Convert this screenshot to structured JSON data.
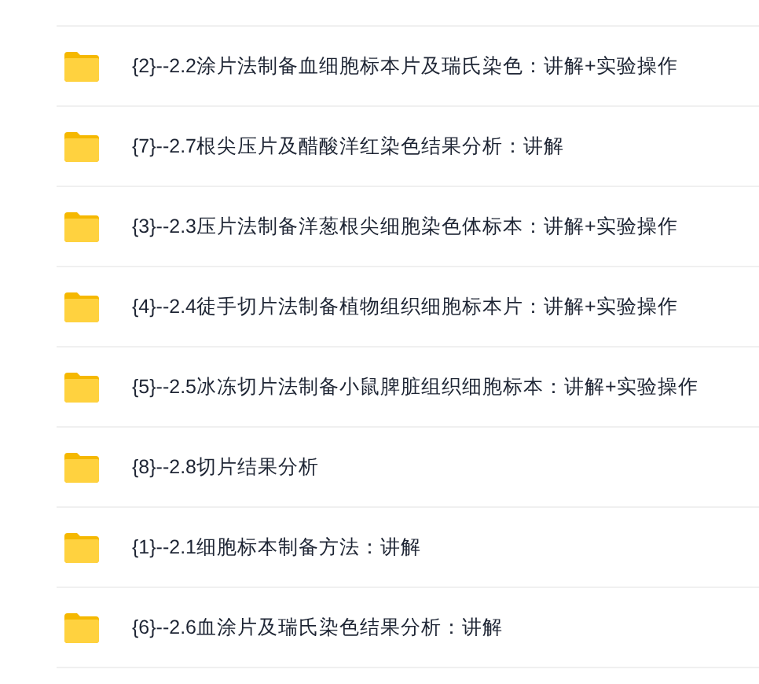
{
  "files": [
    {
      "kind": "folder",
      "name": "{2}--2.2涂片法制备血细胞标本片及瑞氏染色：讲解+实验操作"
    },
    {
      "kind": "folder",
      "name": "{7}--2.7根尖压片及醋酸洋红染色结果分析：讲解"
    },
    {
      "kind": "folder",
      "name": "{3}--2.3压片法制备洋葱根尖细胞染色体标本：讲解+实验操作"
    },
    {
      "kind": "folder",
      "name": "{4}--2.4徒手切片法制备植物组织细胞标本片：讲解+实验操作"
    },
    {
      "kind": "folder",
      "name": "{5}--2.5冰冻切片法制备小鼠脾脏组织细胞标本：讲解+实验操作"
    },
    {
      "kind": "folder",
      "name": "{8}--2.8切片结果分析"
    },
    {
      "kind": "folder",
      "name": "{1}--2.1细胞标本制备方法：讲解"
    },
    {
      "kind": "folder",
      "name": "{6}--2.6血涂片及瑞氏染色结果分析：讲解"
    }
  ]
}
